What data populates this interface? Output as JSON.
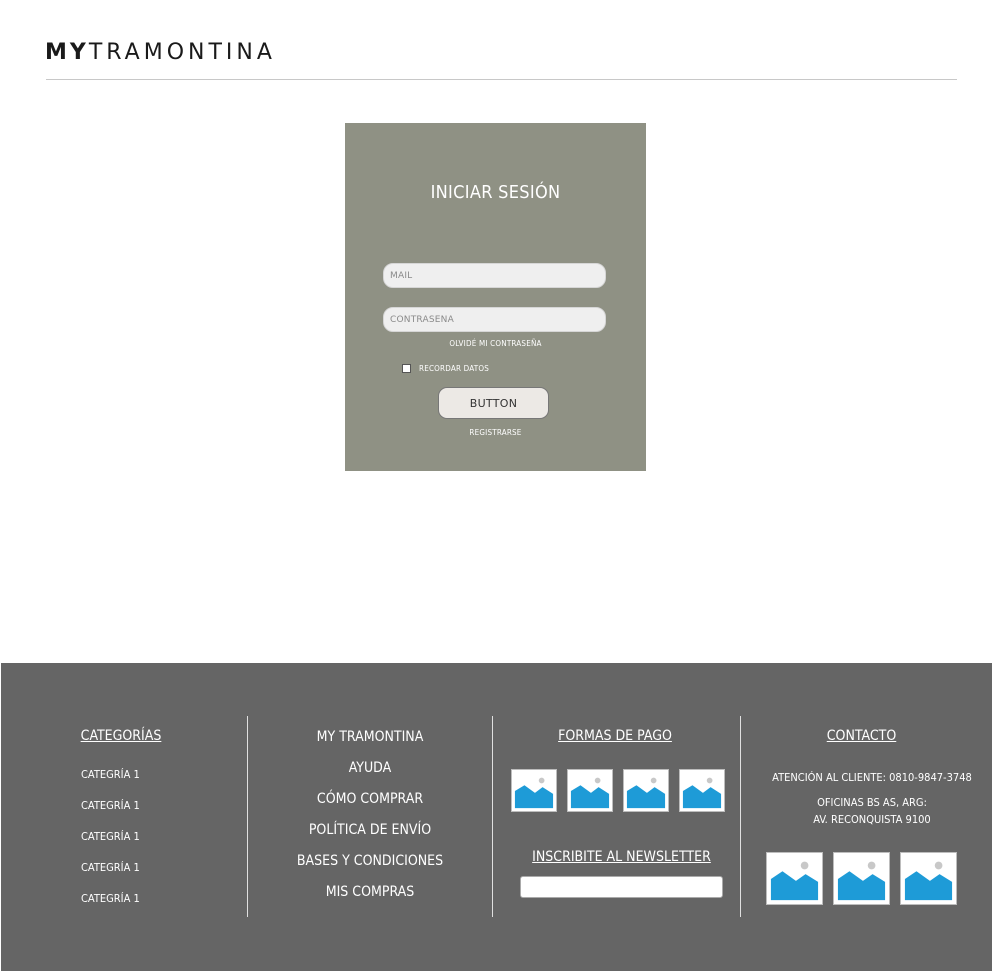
{
  "header": {
    "logo_prefix": "MY",
    "logo_brand": "TRAMONTINA"
  },
  "login": {
    "title": "INICIAR SESIÓN",
    "mail_placeholder": "MAIL",
    "password_placeholder": "CONTRASEÑA",
    "forgot_label": "OLVIDÉ MI CONTRASEÑA",
    "remember_label": "RECORDAR DATOS",
    "submit_label": "BUTTON",
    "register_label": "REGISTRARSE"
  },
  "footer": {
    "categories": {
      "heading": "CATEGORÍAS",
      "items": [
        "CATEGRÍA 1",
        "CATEGRÍA 1",
        "CATEGRÍA 1",
        "CATEGRÍA 1",
        "CATEGRÍA 1"
      ]
    },
    "nav": {
      "items": [
        "MY TRAMONTINA",
        "AYUDA",
        "CÓMO COMPRAR",
        "POLÍTICA DE ENVÍO",
        "BASES Y CONDICIONES",
        "MIS COMPRAS"
      ]
    },
    "payment": {
      "heading": "FORMAS DE PAGO",
      "icons": [
        "image-placeholder-icon",
        "image-placeholder-icon",
        "image-placeholder-icon",
        "image-placeholder-icon"
      ]
    },
    "newsletter": {
      "heading": "INSCRIBITE AL NEWSLETTER",
      "input_value": ""
    },
    "contact": {
      "heading": "CONTACTO",
      "phone": "ATENCIÓN AL CLIENTE: 0810-9847-3748",
      "office_line1": "OFICINAS BS AS, ARG:",
      "office_line2": "AV. RECONQUISTA 9100",
      "social_icons": [
        "image-placeholder-icon",
        "image-placeholder-icon",
        "image-placeholder-icon"
      ]
    }
  },
  "colors": {
    "card_bg": "#8f9184",
    "footer_bg": "#656565",
    "placeholder_sky": "#1e9bd7"
  }
}
